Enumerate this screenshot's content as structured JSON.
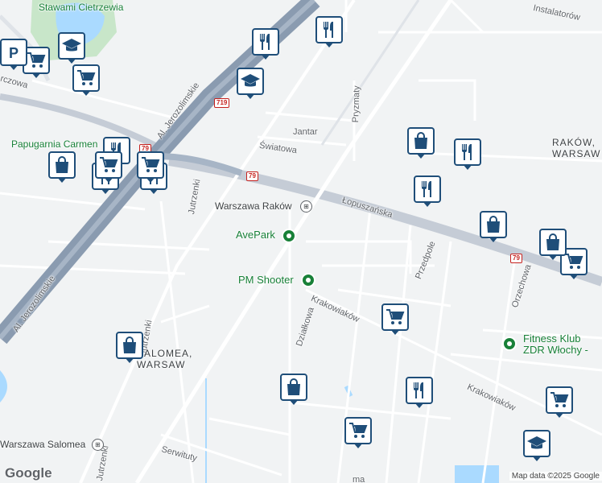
{
  "map": {
    "labels": {
      "stawami": "Stawami Cietrzewia",
      "papugarnia": "Papugarnia Carmen",
      "jerozolimskie_top": "Al. Jerozolimskie",
      "jerozolimskie_bottom": "Al. Jerozolimskie",
      "jutrzenki_top": "Jutrzenki",
      "jutrzenki_mid": "Jutrzenki",
      "jutrzenki_bottom": "Jutrzenki",
      "jantar": "Jantar",
      "swiatowa": "Światowa",
      "pryzmaty": "Pryzmaty",
      "instalatorow": "Instalatorów",
      "lopuszanska": "Łopuszańska",
      "przedpole": "Przedpole",
      "orzechowa": "Orzechowa",
      "krakowiakow_1": "Krakowiaków",
      "krakowiakow_2": "Krakowiaków",
      "dzialkowa": "Działkowa",
      "serwituty": "Serwituty",
      "raków_area": "RAKÓW, WARSAW",
      "salomea_area": "SALOMEA, WARSAW",
      "czowa": "rczowa",
      "ma": "ma",
      "road_719": "719",
      "road_79_a": "79",
      "road_79_b": "79",
      "road_79_c": "79"
    },
    "places": {
      "warszawa_rakow": "Warszawa Raków",
      "warszawa_salomea": "Warszawa Salomea",
      "avepark": "AvePark",
      "pm_shooter": "PM Shooter",
      "fitness_klub": "Fitness Klub ZDR Włochy - Krakow"
    },
    "pins": [
      {
        "icon": "restaurant-icon"
      },
      {
        "icon": "restaurant-icon"
      },
      {
        "icon": "restaurant-icon"
      },
      {
        "icon": "restaurant-icon"
      },
      {
        "icon": "restaurant-icon"
      },
      {
        "icon": "restaurant-icon"
      },
      {
        "icon": "restaurant-icon"
      },
      {
        "icon": "restaurant-icon"
      },
      {
        "icon": "shopping-cart-icon"
      },
      {
        "icon": "shopping-cart-icon"
      },
      {
        "icon": "shopping-cart-icon"
      },
      {
        "icon": "shopping-cart-icon"
      },
      {
        "icon": "shopping-cart-icon"
      },
      {
        "icon": "shopping-cart-icon"
      },
      {
        "icon": "shopping-cart-icon"
      },
      {
        "icon": "shopping-cart-icon"
      },
      {
        "icon": "shopping-bag-icon"
      },
      {
        "icon": "shopping-bag-icon"
      },
      {
        "icon": "shopping-bag-icon"
      },
      {
        "icon": "shopping-bag-icon"
      },
      {
        "icon": "shopping-bag-icon"
      },
      {
        "icon": "shopping-bag-icon"
      },
      {
        "icon": "school-icon"
      },
      {
        "icon": "school-icon"
      },
      {
        "icon": "school-icon"
      },
      {
        "icon": "parking-icon"
      }
    ],
    "logo": "Google",
    "attribution": "Map data ©2025 Google",
    "colors": {
      "pin_border": "#1f4e79",
      "park": "#c8e6c9",
      "water": "#aadaff",
      "highway": "#8a9bb0",
      "road": "#ffffff",
      "poi_green": "#188038"
    }
  }
}
